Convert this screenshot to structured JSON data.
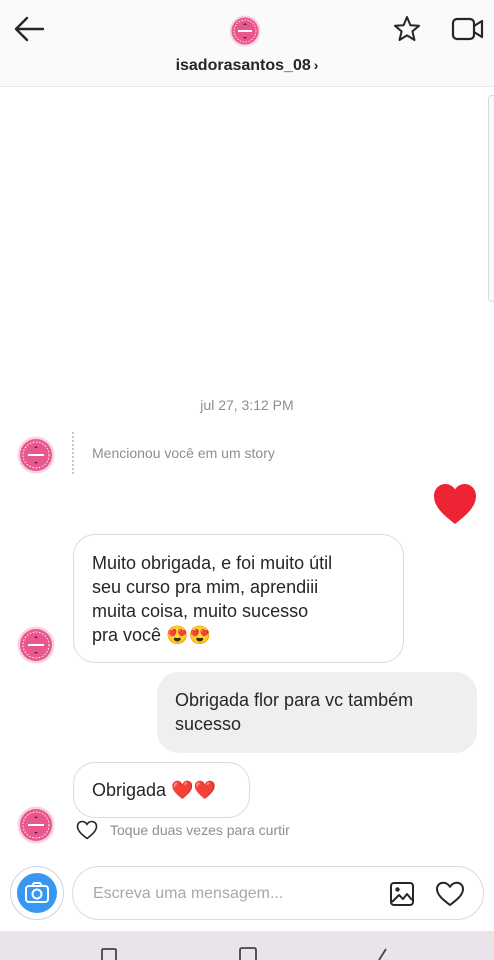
{
  "header": {
    "username": "isadorasantos_08",
    "username_chevron": "›",
    "avatar_label": "CUIDANDO DENTES",
    "icons": [
      "back-arrow-icon",
      "star-icon",
      "video-call-icon"
    ]
  },
  "thread": {
    "timestamp": "jul 27, 3:12 PM",
    "story_mention": "Mencionou você em um story",
    "messages": [
      {
        "from": "them",
        "lines": [
          "Muito obrigada, e foi muito útil",
          "seu curso pra mim, aprendiii",
          "muita coisa, muito sucesso"
        ],
        "last_line": "pra você",
        "emoji": "😍😍"
      },
      {
        "from": "me",
        "lines": [
          "Obrigada flor para vc também",
          "sucesso"
        ]
      },
      {
        "from": "them",
        "text": "Obrigada",
        "emoji": "❤️❤️"
      }
    ],
    "like_hint": "Toque duas vezes para curtir"
  },
  "composer": {
    "placeholder": "Escreva uma mensagem...",
    "icons": [
      "camera-icon",
      "gallery-icon",
      "heart-icon"
    ]
  },
  "colors": {
    "accent_blue": "#3897f0",
    "heart_red": "#ed2433",
    "avatar_pink": "#e8588f"
  }
}
